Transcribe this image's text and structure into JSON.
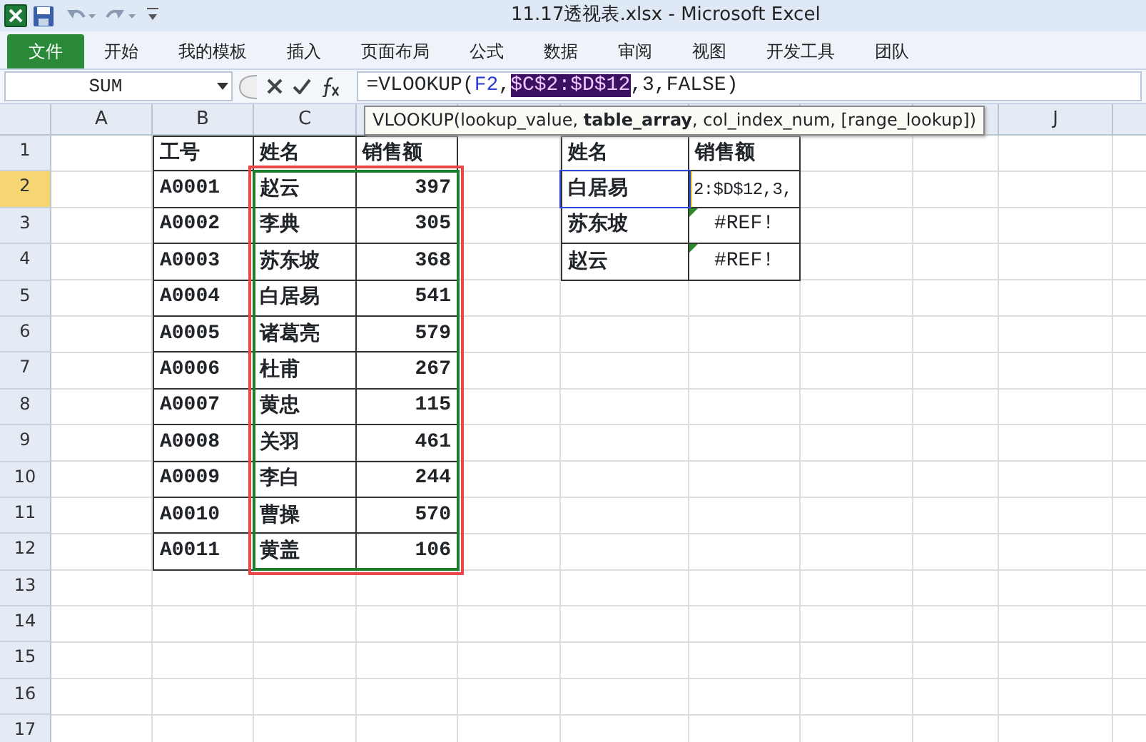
{
  "window": {
    "title": "11.17透视表.xlsx - Microsoft Excel"
  },
  "ribbon": {
    "tabs": [
      {
        "label": "文件",
        "kind": "file",
        "selected": false
      },
      {
        "label": "开始",
        "kind": "tab",
        "selected": false
      },
      {
        "label": "我的模板",
        "kind": "tab",
        "selected": false
      },
      {
        "label": "插入",
        "kind": "tab",
        "selected": false
      },
      {
        "label": "页面布局",
        "kind": "tab",
        "selected": false
      },
      {
        "label": "公式",
        "kind": "tab",
        "selected": false
      },
      {
        "label": "数据",
        "kind": "tab",
        "selected": false
      },
      {
        "label": "审阅",
        "kind": "tab",
        "selected": false
      },
      {
        "label": "视图",
        "kind": "tab",
        "selected": false
      },
      {
        "label": "开发工具",
        "kind": "tab",
        "selected": false
      },
      {
        "label": "团队",
        "kind": "tab",
        "selected": false
      }
    ]
  },
  "formula_bar": {
    "name_box": "SUM",
    "formula": [
      {
        "text": "=VLOOKUP(",
        "kind": "plain"
      },
      {
        "text": "F2",
        "kind": "ref",
        "color": "#2b3fd6"
      },
      {
        "text": ",",
        "kind": "plain"
      },
      {
        "text": "$C$2:$D$12",
        "kind": "selected"
      },
      {
        "text": ",3,FALSE)",
        "kind": "plain"
      }
    ]
  },
  "tooltip": "VLOOKUP(lookup_value, **table_array**, col_index_num, [range_lookup])",
  "sheet": {
    "columns": [
      {
        "label": "A"
      },
      {
        "label": "B"
      },
      {
        "label": "C"
      },
      {},
      {},
      {},
      {},
      {},
      {},
      {
        "label": "J"
      }
    ],
    "rows": [
      {
        "label": "1",
        "selected": false
      },
      {
        "label": "2",
        "selected": true
      },
      {
        "label": "3",
        "selected": false
      },
      {
        "label": "4",
        "selected": false
      },
      {
        "label": "5",
        "selected": false
      },
      {
        "label": "6",
        "selected": false
      },
      {
        "label": "7",
        "selected": false
      },
      {
        "label": "8",
        "selected": false
      },
      {
        "label": "9",
        "selected": false
      },
      {
        "label": "10",
        "selected": false
      },
      {
        "label": "11",
        "selected": false
      },
      {
        "label": "12",
        "selected": false
      },
      {
        "label": "13",
        "selected": false
      },
      {
        "label": "14",
        "selected": false
      },
      {
        "label": "15",
        "selected": false
      },
      {
        "label": "16",
        "selected": false
      },
      {
        "label": "17",
        "selected": false
      }
    ]
  },
  "employee_table": {
    "columns": [
      "工号",
      "姓名",
      "销售额"
    ],
    "reference_highlight": true,
    "annotation_box": true,
    "rows": [
      [
        "A0001",
        "赵云",
        "397"
      ],
      [
        "A0002",
        "李典",
        "305"
      ],
      [
        "A0003",
        "苏东坡",
        "368"
      ],
      [
        "A0004",
        "白居易",
        "541"
      ],
      [
        "A0005",
        "诸葛亮",
        "579"
      ],
      [
        "A0006",
        "杜甫",
        "267"
      ],
      [
        "A0007",
        "黄忠",
        "115"
      ],
      [
        "A0008",
        "关羽",
        "461"
      ],
      [
        "A0009",
        "李白",
        "244"
      ],
      [
        "A0010",
        "曹操",
        "570"
      ],
      [
        "A0011",
        "黄盖",
        "106"
      ]
    ]
  },
  "lookup_table": {
    "columns": [
      "姓名",
      "销售额"
    ],
    "rows": [
      {
        "name": "白居易",
        "result": "2:$D$12,3,",
        "editing": true,
        "referenced": true,
        "error_flag": false
      },
      {
        "name": "苏东坡",
        "result": "#REF!",
        "editing": false,
        "referenced": false,
        "error_flag": true
      },
      {
        "name": "赵云",
        "result": "#REF!",
        "editing": false,
        "referenced": false,
        "error_flag": true
      }
    ]
  }
}
